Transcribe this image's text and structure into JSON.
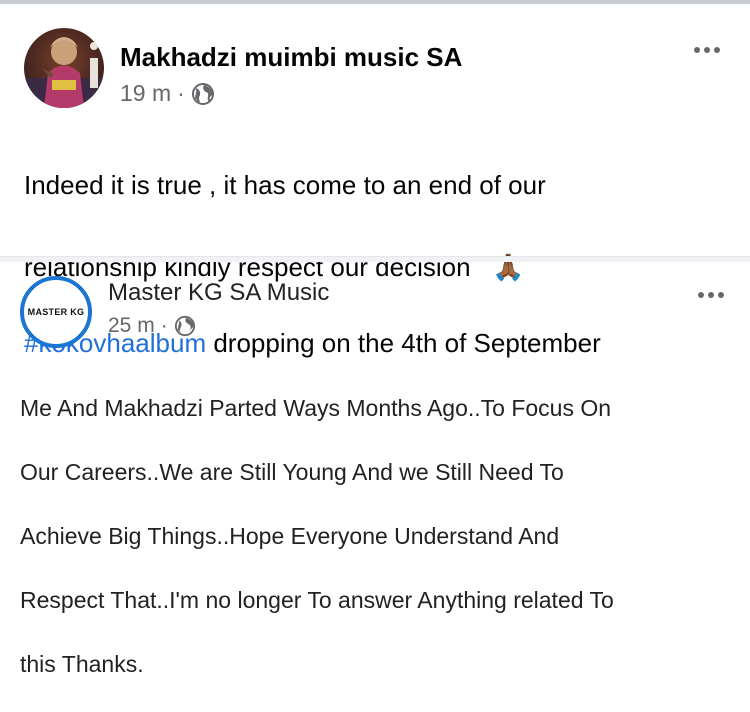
{
  "post1": {
    "author": "Makhadzi muimbi music SA",
    "time": "19 m",
    "separator": "·",
    "privacy_icon": "globe-icon",
    "text_line1": "Indeed it is true , it has come to an end of our",
    "text_line2": "relationship kindly respect our decision",
    "emoji": "🙏🏾",
    "hashtag": "#kokovhaalbum",
    "text_line3_rest": " dropping on the 4th of September"
  },
  "post2": {
    "author": "Master KG SA Music",
    "avatar_text": "MASTER KG",
    "time": "25 m",
    "separator": "·",
    "privacy_icon": "globe-icon",
    "lines": [
      "Me And Makhadzi Parted Ways Months Ago..To Focus On",
      "Our Careers..We are Still Young And we Still Need To",
      "Achieve Big Things..Hope Everyone Understand And",
      "Respect That..I'm no longer To answer Anything related To",
      "this Thanks."
    ]
  },
  "colors": {
    "link": "#216fdb",
    "meta": "#65676b",
    "master_kg_ring": "#1976d2"
  }
}
